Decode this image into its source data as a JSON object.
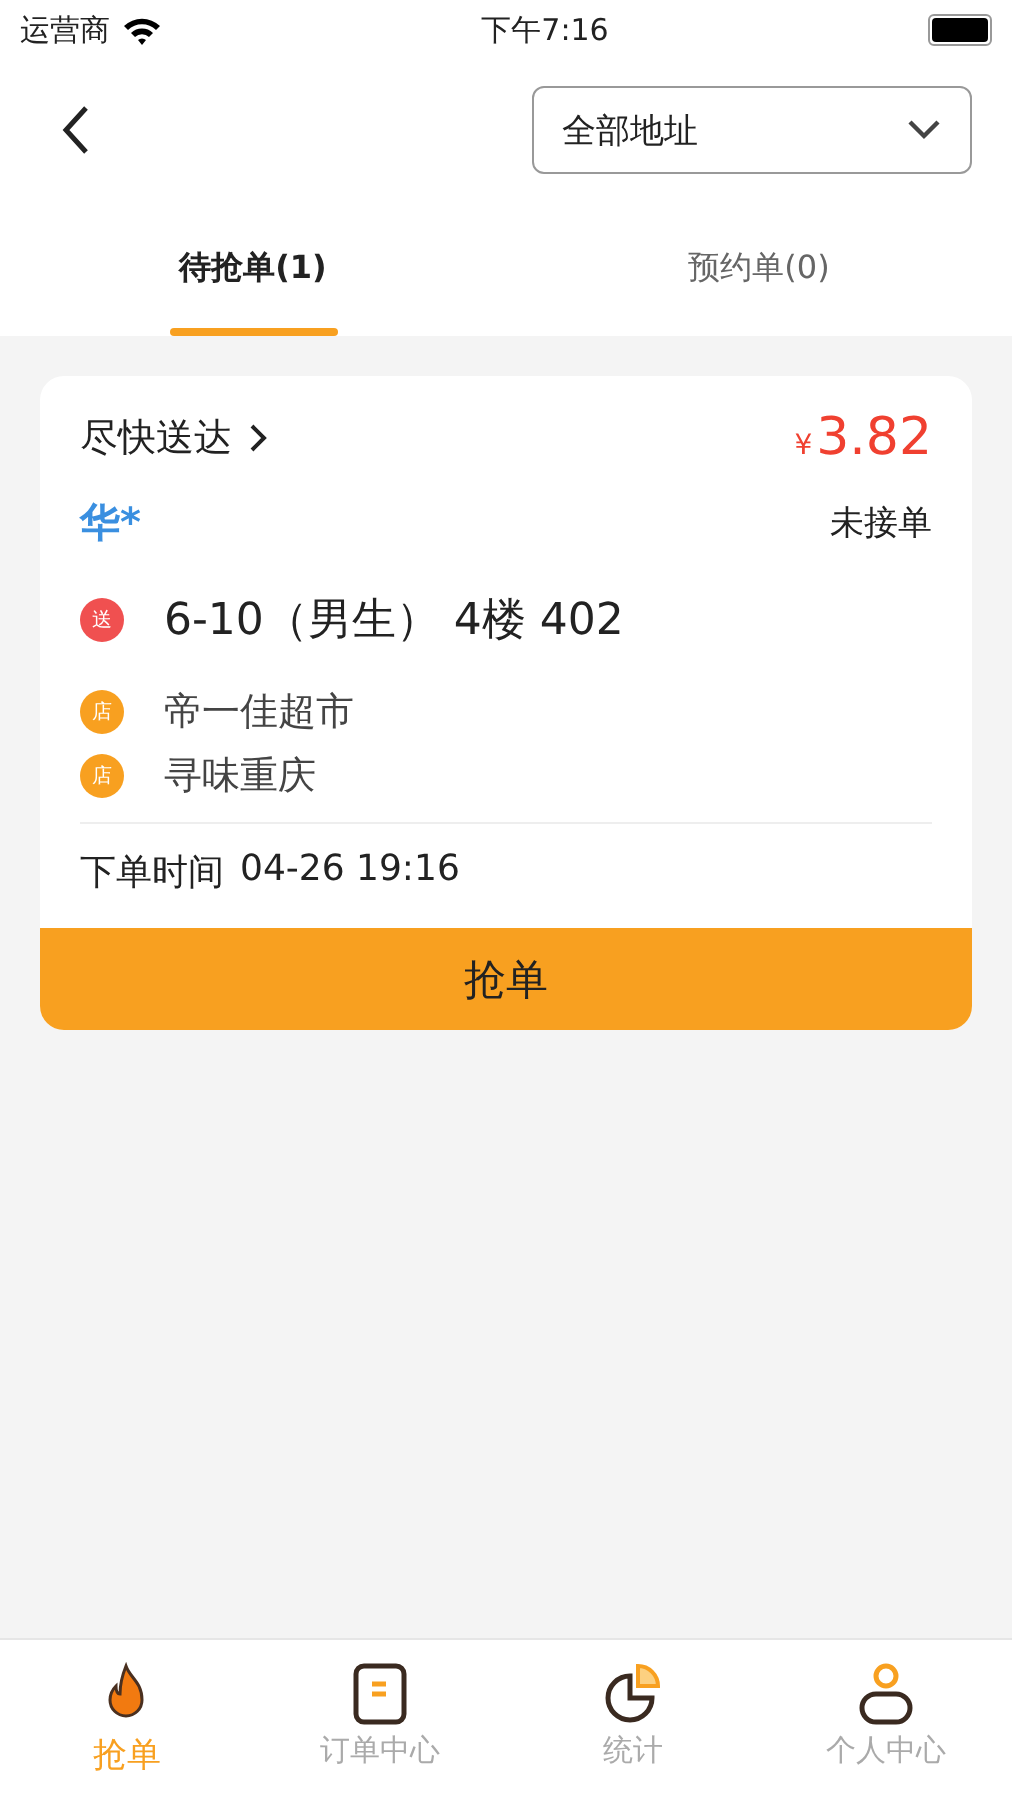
{
  "status_bar": {
    "carrier": "运营商",
    "time": "下午7:16"
  },
  "header": {
    "address_filter": {
      "value": "全部地址"
    }
  },
  "tabs": [
    {
      "label": "待抢单(1)",
      "selected": true
    },
    {
      "label": "预约单(0)",
      "selected": false
    }
  ],
  "orders": [
    {
      "delivery_type": "尽快送达",
      "currency": "¥",
      "price": "3.82",
      "customer": "华*",
      "status": "未接单",
      "destination_tag": "送",
      "destination": "6-10（男生） 4楼 402",
      "shops": [
        {
          "tag": "店",
          "name": "帝一佳超市"
        },
        {
          "tag": "店",
          "name": "寻味重庆"
        }
      ],
      "order_time_label": "下单时间",
      "order_time": "04-26 19:16",
      "action": "抢单"
    }
  ],
  "bottom_nav": [
    {
      "kind": "flame",
      "label": "抢单",
      "selected": true
    },
    {
      "kind": "document",
      "label": "订单中心",
      "selected": false
    },
    {
      "kind": "pie",
      "label": "统计",
      "selected": false
    },
    {
      "kind": "person",
      "label": "个人中心",
      "selected": false
    }
  ]
}
